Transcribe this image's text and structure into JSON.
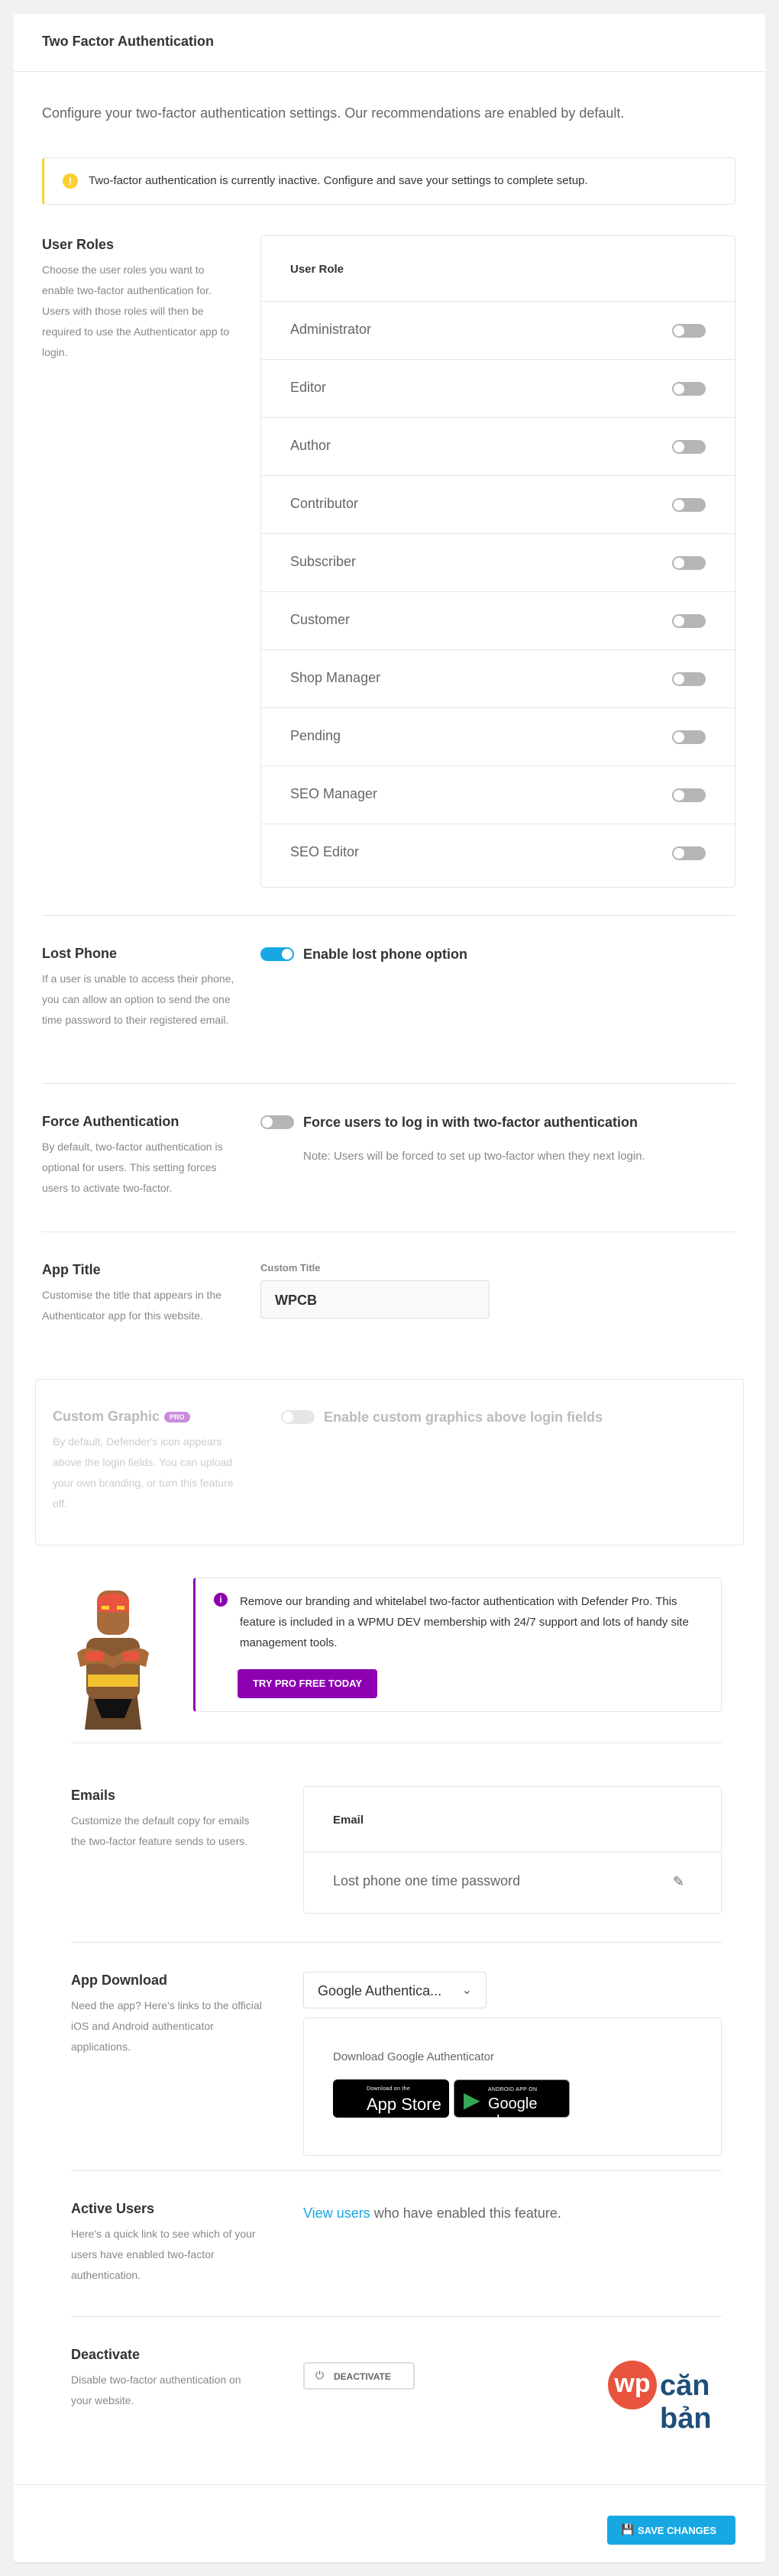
{
  "header": {
    "title": "Two Factor Authentication"
  },
  "intro": "Configure your two-factor authentication settings. Our recommendations are enabled by default.",
  "notice": {
    "text": "Two-factor authentication is currently inactive. Configure and save your settings to complete setup."
  },
  "user_roles": {
    "title": "User Roles",
    "description": "Choose the user roles you want to enable two-factor authentication for. Users with those roles will then be required to use the Authenticator app to login.",
    "column_header": "User Role",
    "roles": [
      {
        "name": "Administrator",
        "enabled": false
      },
      {
        "name": "Editor",
        "enabled": false
      },
      {
        "name": "Author",
        "enabled": false
      },
      {
        "name": "Contributor",
        "enabled": false
      },
      {
        "name": "Subscriber",
        "enabled": false
      },
      {
        "name": "Customer",
        "enabled": false
      },
      {
        "name": "Shop Manager",
        "enabled": false
      },
      {
        "name": "Pending",
        "enabled": false
      },
      {
        "name": "SEO Manager",
        "enabled": false
      },
      {
        "name": "SEO Editor",
        "enabled": false
      }
    ]
  },
  "lost_phone": {
    "title": "Lost Phone",
    "description": "If a user is unable to access their phone, you can allow an option to send the one time password to their registered email.",
    "toggle_label": "Enable lost phone option",
    "enabled": true
  },
  "force_auth": {
    "title": "Force Authentication",
    "description": "By default, two-factor authentication is optional for users. This setting forces users to activate two-factor.",
    "toggle_label": "Force users to log in with two-factor authentication",
    "note": "Note: Users will be forced to set up two-factor when they next login.",
    "enabled": false
  },
  "app_title": {
    "title": "App Title",
    "description": "Customise the title that appears in the Authenticator app for this website.",
    "field_label": "Custom Title",
    "value": "WPCB"
  },
  "custom_graphic": {
    "title": "Custom Graphic",
    "pro_tag": "PRO",
    "description": "By default, Defender's icon appears above the login fields. You can upload your own branding, or turn this feature off.",
    "toggle_label": "Enable custom graphics above login fields",
    "enabled": false
  },
  "upsell": {
    "text": "Remove our branding and whitelabel two-factor authentication with Defender Pro. This feature is included in a WPMU DEV membership with 24/7 support and lots of handy site management tools.",
    "button_label": "TRY PRO FREE TODAY"
  },
  "emails": {
    "title": "Emails",
    "description": "Customize the default copy for emails the two-factor feature sends to users.",
    "column_header": "Email",
    "row_label": "Lost phone one time password"
  },
  "app_download": {
    "title": "App Download",
    "description": "Need the app? Here's links to the official iOS and Android authenticator applications.",
    "selected_app": "Google Authentica...",
    "download_title": "Download Google Authenticator",
    "app_store": {
      "small": "Download on the",
      "big": "App Store"
    },
    "google_play": {
      "small": "ANDROID APP ON",
      "big": "Google play"
    }
  },
  "active_users": {
    "title": "Active Users",
    "description": "Here's a quick link to see which of your users have enabled two-factor authentication.",
    "link_text": "View users",
    "trailing_text": " who have enabled this feature."
  },
  "deactivate": {
    "title": "Deactivate",
    "description": "Disable two-factor authentication on your website.",
    "button_label": "DEACTIVATE"
  },
  "watermark": {
    "circle": "wp",
    "text": "căn bản"
  },
  "footer": {
    "save_label": "SAVE CHANGES"
  },
  "colors": {
    "accent": "#17a8e3",
    "pro": "#8d00b1",
    "warning": "#fecf2f",
    "brand_red": "#e9543f",
    "brand_blue": "#1f4e79"
  }
}
